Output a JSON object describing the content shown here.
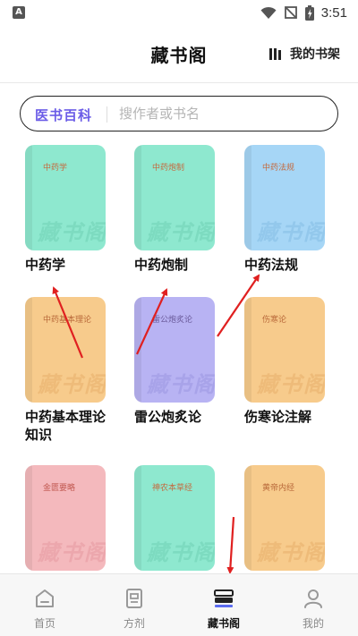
{
  "status_bar": {
    "time": "3:51",
    "app_icon_letter": "A"
  },
  "header": {
    "title": "藏书阁",
    "shelf_label": "我的书架"
  },
  "search": {
    "category": "医书百科",
    "placeholder": "搜作者或书名",
    "value": ""
  },
  "books": [
    {
      "cover_title": "中药学",
      "watermark": "藏书阁",
      "name": "中药学",
      "color": "#8ee8cf"
    },
    {
      "cover_title": "中药炮制",
      "watermark": "藏书阁",
      "name": "中药炮制",
      "color": "#8ee8cf"
    },
    {
      "cover_title": "中药法规",
      "watermark": "藏书阁",
      "name": "中药法规",
      "color": "#a6d6f6"
    },
    {
      "cover_title": "中药基本理论",
      "watermark": "藏书阁",
      "name_line1": "中药基本理论",
      "name_line2": "知识",
      "color": "#f7cb8c"
    },
    {
      "cover_title": "雷公炮炙论",
      "watermark": "藏书阁",
      "name": "雷公炮炙论",
      "color": "#b8b3f3"
    },
    {
      "cover_title": "伤寒论",
      "watermark": "藏书阁",
      "name": "伤寒论注解",
      "color": "#f7cb8c"
    },
    {
      "cover_title": "金匮要略",
      "watermark": "藏书阁",
      "color": "#f4b9bd"
    },
    {
      "cover_title": "神农本草经",
      "watermark": "藏书阁",
      "color": "#8ee8cf"
    },
    {
      "cover_title": "黄帝内经",
      "watermark": "藏书阁",
      "color": "#f7cb8c"
    }
  ],
  "bottom_nav": [
    {
      "label": "首页",
      "icon": "home-icon",
      "active": false
    },
    {
      "label": "方剂",
      "icon": "document-icon",
      "active": false
    },
    {
      "label": "藏书阁",
      "icon": "books-icon",
      "active": true
    },
    {
      "label": "我的",
      "icon": "user-icon",
      "active": false
    }
  ],
  "annotation_color": "#e02020"
}
